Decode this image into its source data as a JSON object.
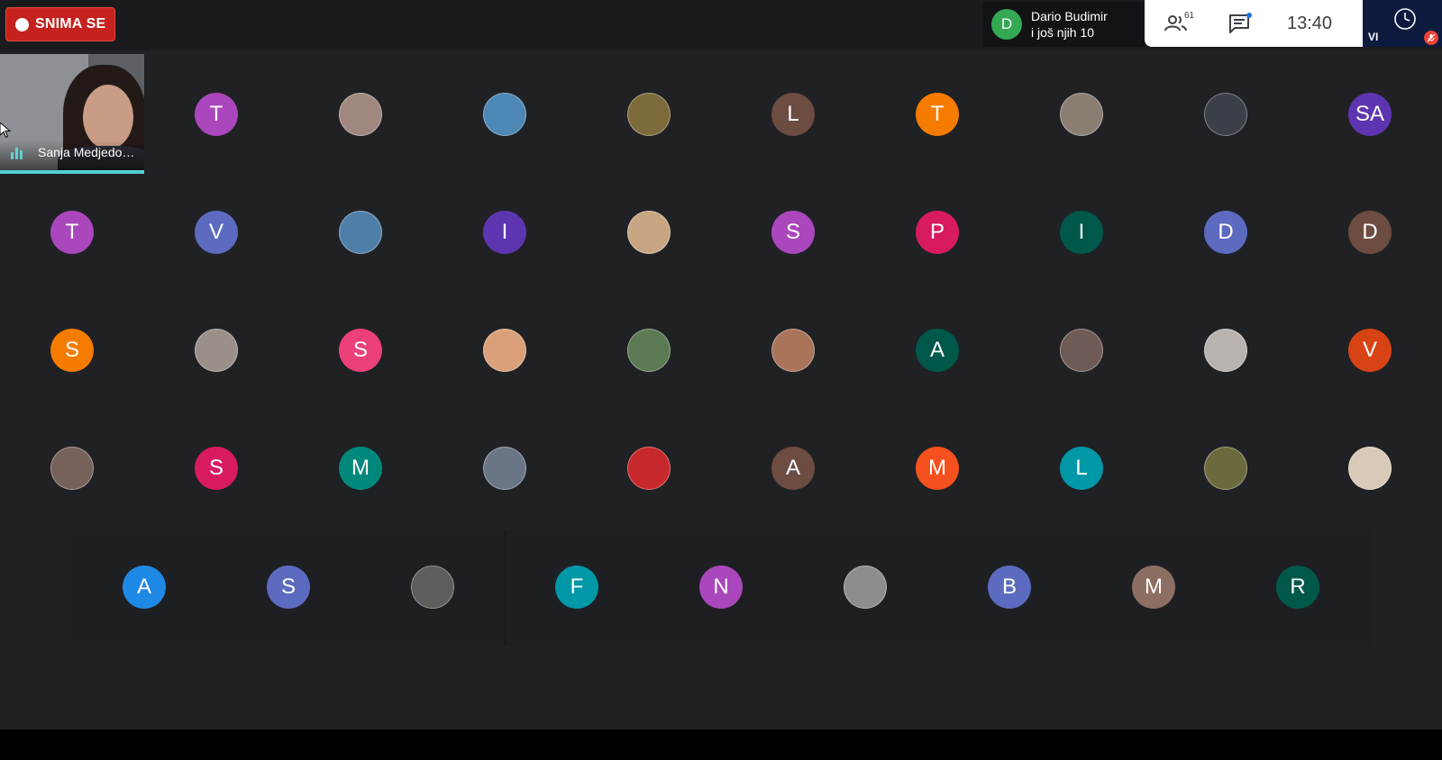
{
  "recording": {
    "label": "SNIMA SE",
    "color": "#c5221f"
  },
  "presenter": {
    "initial": "D",
    "name": "Dario Budimir",
    "others": "i još njih 10",
    "color": "#34a853"
  },
  "meeting_panel": {
    "participant_count": "61",
    "people_icon": "people-icon",
    "chat_icon": "chat-icon",
    "time": "13:40"
  },
  "self_view": {
    "label": "VI",
    "mic_status": "muted"
  },
  "speaker": {
    "name": "Sanja Medjedo…"
  },
  "participants": [
    {
      "initial": "T",
      "color": "#ab47bc"
    },
    {
      "initial": "",
      "color": "#a08880",
      "photo": true
    },
    {
      "initial": "",
      "color": "#4c87b5",
      "photo": true
    },
    {
      "initial": "",
      "color": "#7c6a3a",
      "photo": true
    },
    {
      "initial": "L",
      "color": "#6d4c41"
    },
    {
      "initial": "T",
      "color": "#f57c00"
    },
    {
      "initial": "",
      "color": "#8a7d72",
      "photo": true
    },
    {
      "initial": "",
      "color": "#3b3f47",
      "photo": true
    },
    {
      "initial": "SA",
      "color": "#5e35b1"
    },
    {
      "initial": "T",
      "color": "#ab47bc"
    },
    {
      "initial": "V",
      "color": "#5c6bc0"
    },
    {
      "initial": "",
      "color": "#4f7fa8",
      "photo": true
    },
    {
      "initial": "I",
      "color": "#5e35b1"
    },
    {
      "initial": "",
      "color": "#c7a583",
      "photo": true
    },
    {
      "initial": "S",
      "color": "#ab47bc"
    },
    {
      "initial": "P",
      "color": "#d81b60"
    },
    {
      "initial": "I",
      "color": "#00584b"
    },
    {
      "initial": "D",
      "color": "#5c6bc0"
    },
    {
      "initial": "D",
      "color": "#6d4c41"
    },
    {
      "initial": "S",
      "color": "#f57c00"
    },
    {
      "initial": "",
      "color": "#9a8f89",
      "photo": true
    },
    {
      "initial": "S",
      "color": "#ec407a"
    },
    {
      "initial": "",
      "color": "#d9a07a",
      "photo": true
    },
    {
      "initial": "",
      "color": "#5b7a53",
      "photo": true
    },
    {
      "initial": "",
      "color": "#a9745a",
      "photo": true
    },
    {
      "initial": "A",
      "color": "#00584b"
    },
    {
      "initial": "",
      "color": "#6f5b55",
      "photo": true
    },
    {
      "initial": "",
      "color": "#b9b3b0",
      "photo": true
    },
    {
      "initial": "V",
      "color": "#d84315"
    },
    {
      "initial": "",
      "color": "#76625b",
      "photo": true
    },
    {
      "initial": "S",
      "color": "#d81b60"
    },
    {
      "initial": "M",
      "color": "#00897b"
    },
    {
      "initial": "",
      "color": "#6a7685",
      "photo": true
    },
    {
      "initial": "",
      "color": "#c6282b",
      "photo": true
    },
    {
      "initial": "A",
      "color": "#6d4c41"
    },
    {
      "initial": "M",
      "color": "#f4511e"
    },
    {
      "initial": "L",
      "color": "#0097a7"
    },
    {
      "initial": "",
      "color": "#6b6a3e",
      "photo": true
    },
    {
      "initial": "",
      "color": "#d8c9b8",
      "photo": true
    }
  ],
  "lower_participants": [
    {
      "initial": "A",
      "color": "#1e88e5"
    },
    {
      "initial": "S",
      "color": "#5c6bc0"
    },
    {
      "initial": "",
      "color": "#5b5e5a",
      "photo": true
    },
    {
      "initial": "F",
      "color": "#0097a7"
    },
    {
      "initial": "N",
      "color": "#ab47bc"
    },
    {
      "initial": "",
      "color": "#8d8c8f",
      "photo": true
    },
    {
      "initial": "B",
      "color": "#5c6bc0"
    },
    {
      "initial": "M",
      "color": "#8d6e63"
    },
    {
      "initial": "R",
      "color": "#00584b"
    }
  ]
}
